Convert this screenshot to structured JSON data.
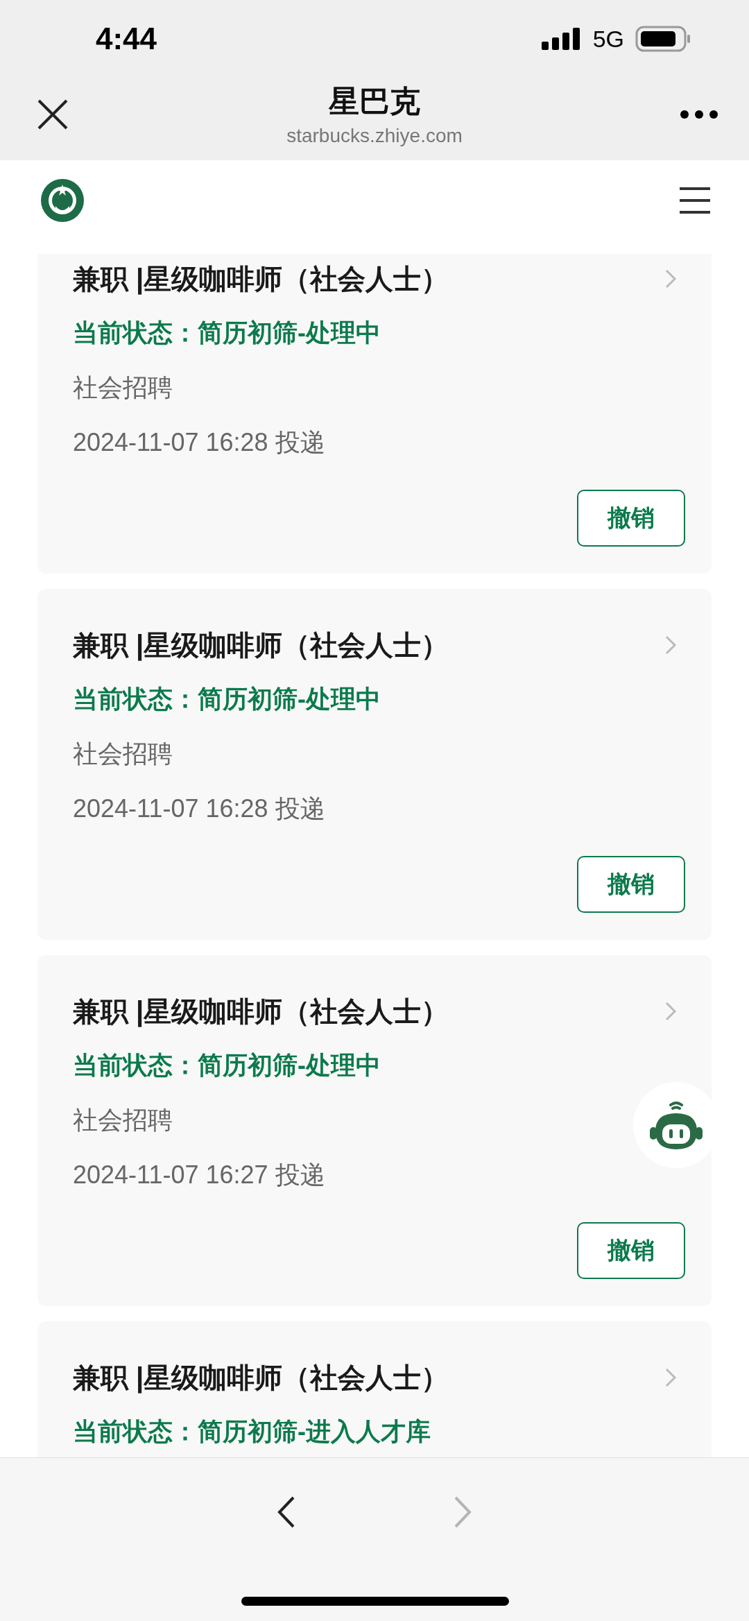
{
  "status_bar": {
    "time": "4:44",
    "network": "5G"
  },
  "nav_bar": {
    "title": "星巴克",
    "url": "starbucks.zhiye.com"
  },
  "applications": [
    {
      "title": "兼职 |星级咖啡师（社会人士）",
      "status": "当前状态：简历初筛-处理中",
      "category": "社会招聘",
      "submitted": "2024-11-07 16:28 投递",
      "action": "撤销"
    },
    {
      "title": "兼职 |星级咖啡师（社会人士）",
      "status": "当前状态：简历初筛-处理中",
      "category": "社会招聘",
      "submitted": "2024-11-07 16:28 投递",
      "action": "撤销"
    },
    {
      "title": "兼职 |星级咖啡师（社会人士）",
      "status": "当前状态：简历初筛-处理中",
      "category": "社会招聘",
      "submitted": "2024-11-07 16:27 投递",
      "action": "撤销"
    },
    {
      "title": "兼职 |星级咖啡师（社会人士）",
      "status": "当前状态：简历初筛-进入人才库"
    }
  ],
  "bottom_nav": [
    {
      "kind": "back",
      "disabled": false
    },
    {
      "kind": "forward",
      "disabled": true
    }
  ]
}
